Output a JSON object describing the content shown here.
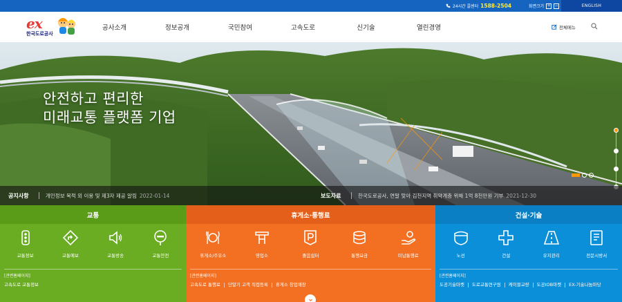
{
  "utility": {
    "call_label": "24시간 콜센터",
    "call_number": "1588-2504",
    "zoom_label": "화면크기",
    "zoom_in": "+",
    "zoom_out": "−",
    "english": "ENGLISH"
  },
  "header": {
    "logo_mark": "ex",
    "logo_name": "한국도로공사",
    "nav": [
      "공사소개",
      "정보공개",
      "국민참여",
      "고속도로",
      "신기술",
      "열린경영"
    ],
    "all_menu": "전체메뉴"
  },
  "hero": {
    "title_line1": "안전하고 편리한",
    "title_line2": "미래교통 플랫폼 기업"
  },
  "notice": {
    "notice_label": "공지사항",
    "notice_text": "개인정보 목적 외 이용 및 제3자 제공 알림",
    "notice_date": "2022-01-14",
    "press_label": "보도자료",
    "press_text": "한국도로공사, 연말 맞아 김천지역 취약계층 위해 1억 8천만원 기부",
    "press_date": "2021-12-30"
  },
  "panels": {
    "traffic": {
      "title": "교통",
      "items": [
        "교통정보",
        "교통예보",
        "교통방송",
        "교통안전"
      ],
      "related_title": "[관련홈페이지]",
      "links": [
        "고속도로 교통정보"
      ]
    },
    "rest": {
      "title": "휴게소·통행료",
      "items": [
        "휴게소/주유소",
        "영업소",
        "졸음쉼터",
        "통행요금",
        "미납통행료"
      ],
      "related_title": "[관련홈페이지]",
      "links": [
        "고속도로 통행료",
        "단말기 고객 직접등록",
        "휴게소 창업매장"
      ]
    },
    "construction": {
      "title": "건설·기술",
      "items": [
        "노선",
        "건설",
        "유지관리",
        "전문시방서"
      ],
      "related_title": "[관련홈페이지]",
      "links": [
        "도공기술마켓",
        "도로교통연구원",
        "케이블교량",
        "도공IOB마켓",
        "EX-기술나눔마당"
      ]
    }
  },
  "colors": {
    "utility_bg": "#1565c0",
    "traffic": "#6aac22",
    "rest": "#f36f21",
    "construction": "#0b8fd8",
    "accent": "#ff9800"
  }
}
